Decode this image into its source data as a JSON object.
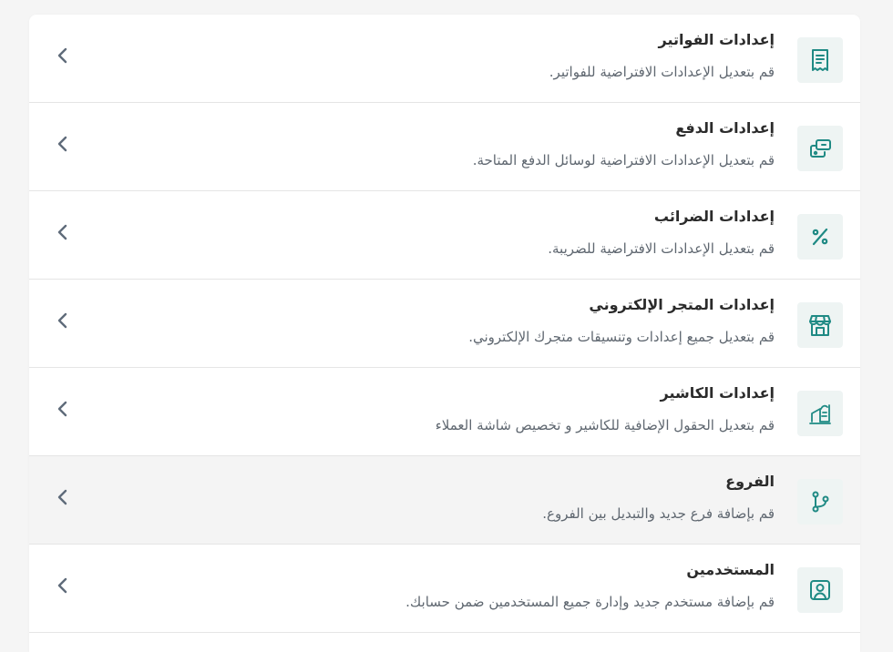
{
  "colors": {
    "accent": "#1f8a84",
    "icon_bg": "#eef4f3",
    "title": "#2b2b2b",
    "description": "#5f6770",
    "chevron": "#5f6b7a"
  },
  "settings": {
    "items": [
      {
        "icon": "receipt-icon",
        "title": "إعدادات الفواتير",
        "description": "قم بتعديل الإعدادات الافتراضية للفواتير."
      },
      {
        "icon": "payment-icon",
        "title": "إعدادات الدفع",
        "description": "قم بتعديل الإعدادات الافتراضية لوسائل الدفع المتاحة."
      },
      {
        "icon": "percent-icon",
        "title": "إعدادات الضرائب",
        "description": "قم بتعديل الإعدادات الافتراضية للضريبة."
      },
      {
        "icon": "store-icon",
        "title": "إعدادات المتجر الإلكتروني",
        "description": "قم بتعديل جميع إعدادات وتنسيقات متجرك الإلكتروني."
      },
      {
        "icon": "cash-register-icon",
        "title": "إعدادات الكاشير",
        "description": "قم بتعديل الحقول الإضافية للكاشير و تخصيص شاشة العملاء"
      },
      {
        "icon": "branch-icon",
        "title": "الفروع",
        "description": "قم بإضافة فرع جديد والتبديل بين الفروع."
      },
      {
        "icon": "user-icon",
        "title": "المستخدمين",
        "description": "قم بإضافة مستخدم جديد وإدارة جميع المستخدمين ضمن حسابك."
      }
    ]
  }
}
